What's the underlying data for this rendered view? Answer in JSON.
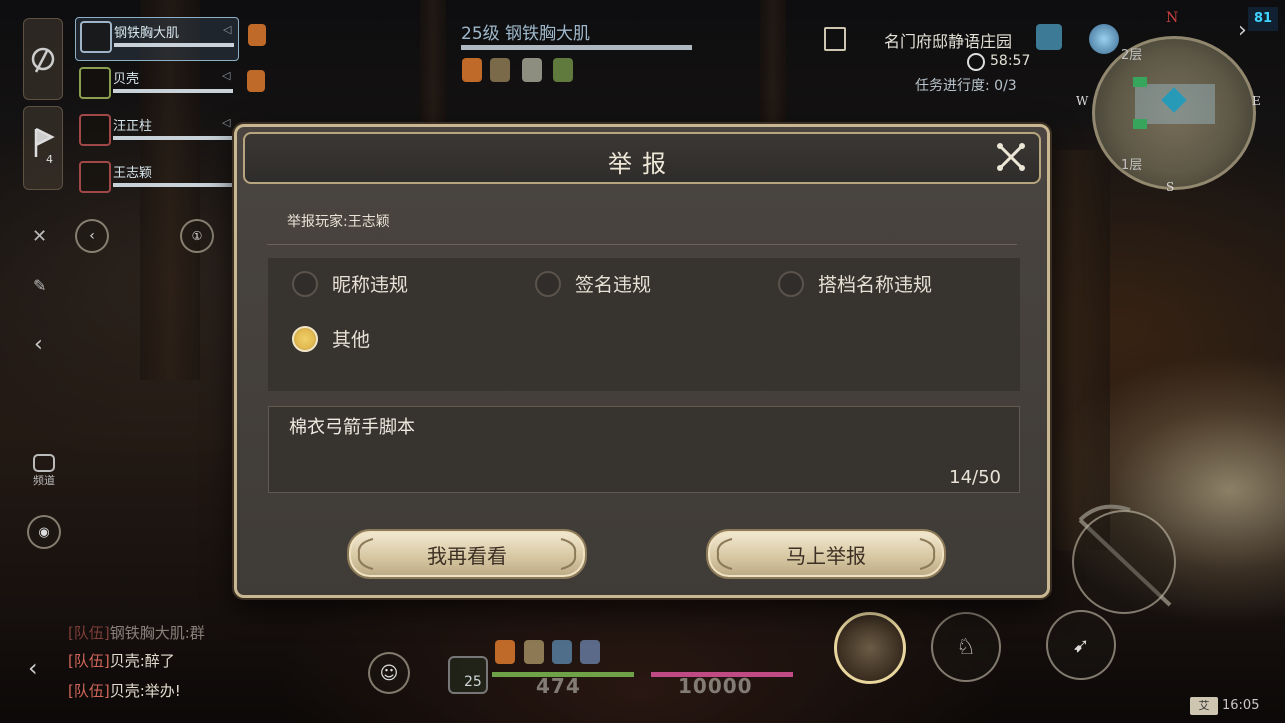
{
  "hud": {
    "fps": "81",
    "target": {
      "title": "25级   钢铁胸大肌"
    },
    "location": {
      "name": "名门府邸静语庄园",
      "time": "58:57",
      "task_progress": "任务进行度: 0/3"
    },
    "minimap": {
      "north": "N",
      "south": "S",
      "east": "E",
      "west": "W",
      "floor_top": "2层",
      "floor_bottom": "1层"
    },
    "left_rail": {
      "quest_count": "4",
      "channel_label": "频道"
    },
    "team": [
      {
        "name": "钢铁胸大肌",
        "active": true
      },
      {
        "name": "贝壳",
        "active": false
      },
      {
        "name": "汪正柱",
        "active": false
      },
      {
        "name": "王志颖",
        "active": false
      }
    ],
    "chat": [
      {
        "tag": "[队伍]",
        "text": "钢铁胸大肌:群"
      },
      {
        "tag": "[队伍]",
        "text": "贝壳:醉了"
      },
      {
        "tag": "[队伍]",
        "text": "贝壳:举办!"
      }
    ],
    "player": {
      "level": "25",
      "hp": "474",
      "mp": "10000"
    },
    "clock": "16:05",
    "colors": {
      "hp": "#6fa248",
      "mp": "#c04a84",
      "fps": "#3fd4ff"
    }
  },
  "dialog": {
    "title": "举报",
    "reported_player": "举报玩家:王志颖",
    "reasons": [
      {
        "label": "昵称违规",
        "checked": false
      },
      {
        "label": "签名违规",
        "checked": false
      },
      {
        "label": "搭档名称违规",
        "checked": false
      },
      {
        "label": "其他",
        "checked": true
      }
    ],
    "text_value": "棉衣弓箭手脚本",
    "char_count": "14/50",
    "cancel_label": "我再看看",
    "confirm_label": "马上举报",
    "colors": {
      "accent": "#e3bb52",
      "border": "#c9b791"
    }
  }
}
